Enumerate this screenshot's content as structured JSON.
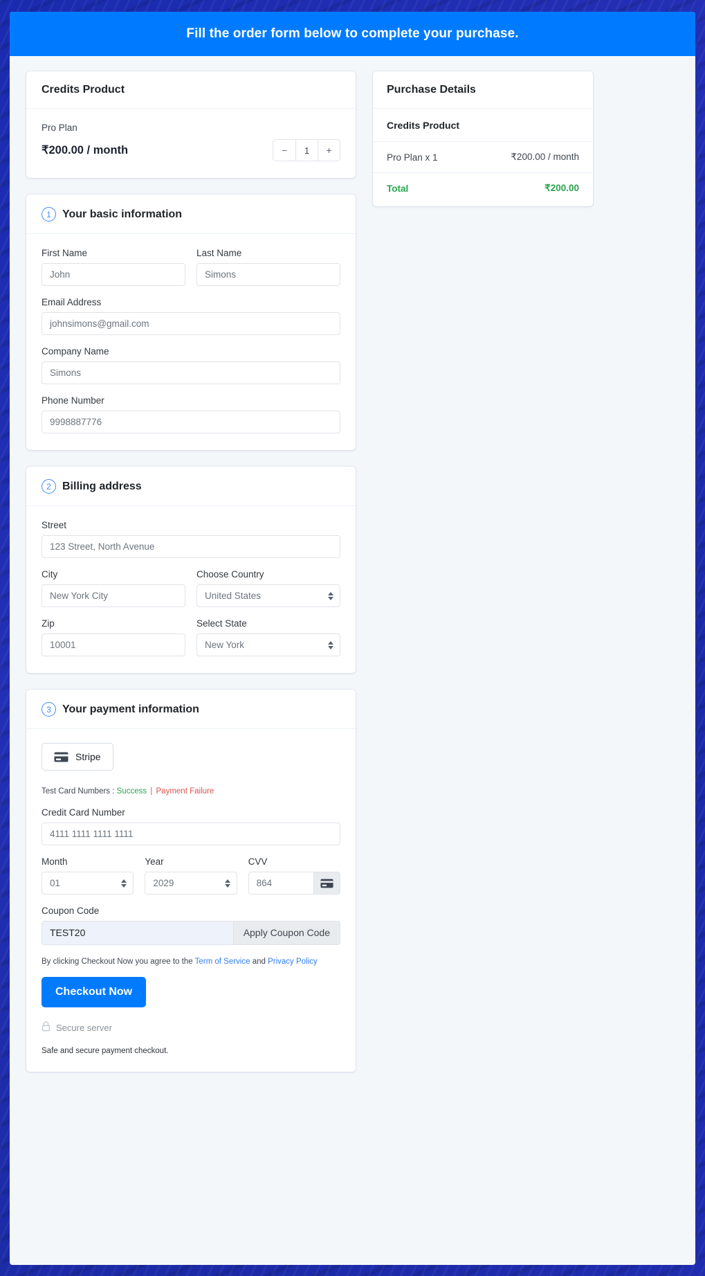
{
  "banner": {
    "title": "Fill the order form below to complete your purchase."
  },
  "product_card": {
    "heading": "Credits Product",
    "plan_name": "Pro Plan",
    "price": "₹200.00 / month",
    "stepper": {
      "decrement_label": "−",
      "quantity": "1",
      "increment_label": "+"
    }
  },
  "purchase_details": {
    "heading": "Purchase Details",
    "section_title": "Credits Product",
    "line_item": {
      "label": "Pro Plan x 1",
      "amount": "₹200.00 / month"
    },
    "total": {
      "label": "Total",
      "amount": "₹200.00"
    }
  },
  "basic_information": {
    "step": "1",
    "heading": "Your basic information",
    "fields": {
      "first_name": {
        "label": "First Name",
        "value": "John"
      },
      "last_name": {
        "label": "Last Name",
        "value": "Simons"
      },
      "email": {
        "label": "Email Address",
        "value": "johnsimons@gmail.com"
      },
      "company": {
        "label": "Company Name",
        "value": "Simons"
      },
      "phone": {
        "label": "Phone Number",
        "value": "9998887776"
      }
    }
  },
  "billing_address": {
    "step": "2",
    "heading": "Billing address",
    "fields": {
      "street": {
        "label": "Street",
        "value": "123 Street, North Avenue"
      },
      "city": {
        "label": "City",
        "value": "New York City"
      },
      "country": {
        "label": "Choose Country",
        "value": "United States"
      },
      "zip": {
        "label": "Zip",
        "value": "10001"
      },
      "state": {
        "label": "Select State",
        "value": "New York"
      }
    }
  },
  "payment_information": {
    "step": "3",
    "heading": "Your payment information",
    "method": {
      "label": "Stripe",
      "icon": "credit-card-icon"
    },
    "test_cards": {
      "prefix": "Test Card Numbers : ",
      "success": "Success",
      "separator": " | ",
      "failure": "Payment Failure"
    },
    "fields": {
      "card_number": {
        "label": "Credit Card Number",
        "value": "4111 1111 1111 1111"
      },
      "month": {
        "label": "Month",
        "value": "01"
      },
      "year": {
        "label": "Year",
        "value": "2029"
      },
      "cvv": {
        "label": "CVV",
        "value": "864",
        "append_icon": "credit-card-icon"
      },
      "coupon": {
        "label": "Coupon Code",
        "value": "TEST20",
        "apply_label": "Apply Coupon Code"
      }
    },
    "agreement": {
      "prefix": "By clicking Checkout Now you agree to the ",
      "terms_link": "Term of Service",
      "conjunction": " and ",
      "privacy_link": "Privacy Policy"
    },
    "checkout_button": "Checkout Now",
    "secure_server": "Secure server",
    "footer_note": "Safe and secure payment checkout."
  },
  "colors": {
    "accent_blue": "#007bff",
    "page_background": "#1d2bad",
    "success_green": "#2aa44f",
    "danger_red": "#d9534f",
    "step_badge_blue": "#3d8bfd"
  }
}
